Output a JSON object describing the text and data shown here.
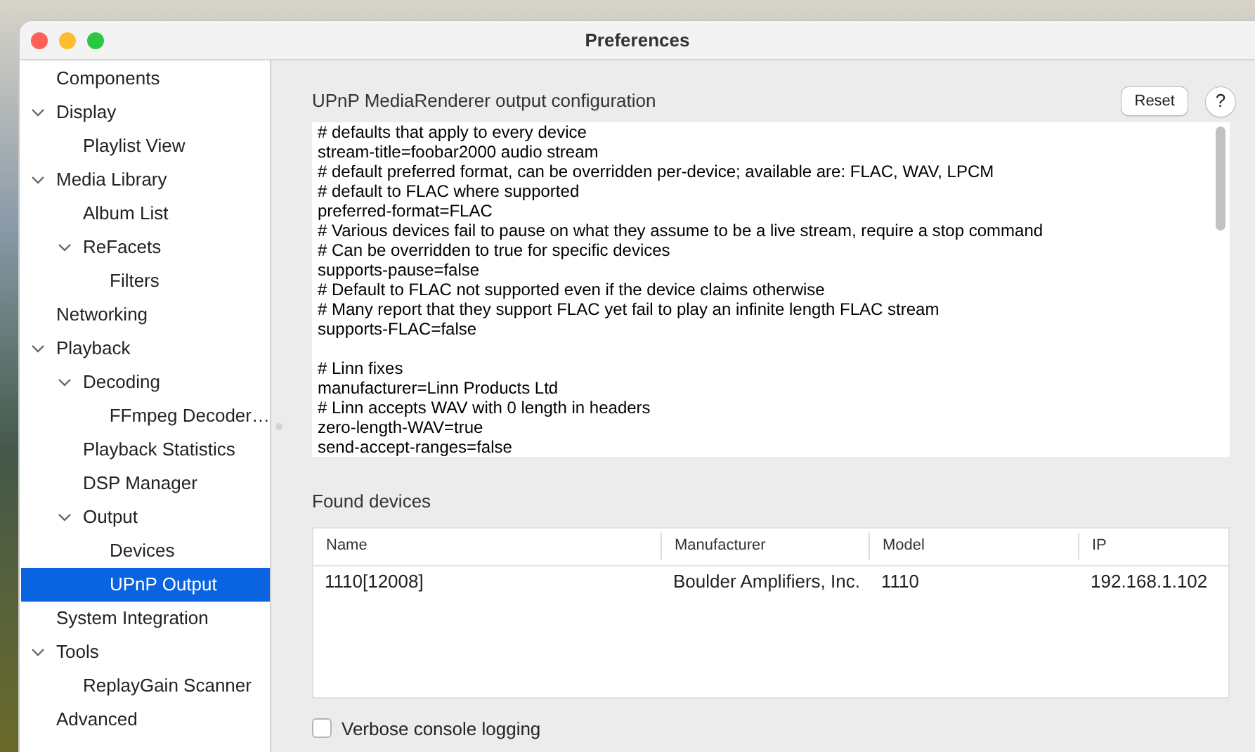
{
  "window": {
    "title": "Preferences"
  },
  "sidebar": {
    "items": [
      {
        "label": "Components",
        "selected": false
      },
      {
        "label": "Display",
        "expanded": true,
        "selected": false,
        "children": [
          {
            "label": "Playlist View",
            "selected": false
          }
        ]
      },
      {
        "label": "Media Library",
        "expanded": true,
        "selected": false,
        "children": [
          {
            "label": "Album List",
            "selected": false
          },
          {
            "label": "ReFacets",
            "expanded": true,
            "selected": false,
            "children": [
              {
                "label": "Filters",
                "selected": false
              }
            ]
          }
        ]
      },
      {
        "label": "Networking",
        "selected": false
      },
      {
        "label": "Playback",
        "expanded": true,
        "selected": false,
        "children": [
          {
            "label": "Decoding",
            "expanded": true,
            "selected": false,
            "children": [
              {
                "label": "FFmpeg Decoder…",
                "selected": false
              }
            ]
          },
          {
            "label": "Playback Statistics",
            "selected": false
          },
          {
            "label": "DSP Manager",
            "selected": false
          },
          {
            "label": "Output",
            "expanded": true,
            "selected": false,
            "children": [
              {
                "label": "Devices",
                "selected": false
              },
              {
                "label": "UPnP Output",
                "selected": true
              }
            ]
          }
        ]
      },
      {
        "label": "System Integration",
        "selected": false
      },
      {
        "label": "Tools",
        "expanded": true,
        "selected": false,
        "children": [
          {
            "label": "ReplayGain Scanner",
            "selected": false
          }
        ]
      },
      {
        "label": "Advanced",
        "selected": false
      }
    ]
  },
  "config": {
    "title": "UPnP MediaRenderer output configuration",
    "reset_button": "Reset",
    "help_button": "?",
    "text": "# defaults that apply to every device\nstream-title=foobar2000 audio stream\n# default preferred format, can be overridden per-device; available are: FLAC, WAV, LPCM\n# default to FLAC where supported\npreferred-format=FLAC\n# Various devices fail to pause on what they assume to be a live stream, require a stop command\n# Can be overridden to true for specific devices\nsupports-pause=false\n# Default to FLAC not supported even if the device claims otherwise\n# Many report that they support FLAC yet fail to play an infinite length FLAC stream\nsupports-FLAC=false\n\n# Linn fixes\nmanufacturer=Linn Products Ltd\n# Linn accepts WAV with 0 length in headers\nzero-length-WAV=true\nsend-accept-ranges=false"
  },
  "devices": {
    "title": "Found devices",
    "columns": [
      "Name",
      "Manufacturer",
      "Model",
      "IP"
    ],
    "rows": [
      {
        "cells": [
          "1110[12008]",
          "Boulder Amplifiers, Inc.",
          "1110",
          "192.168.1.102"
        ],
        "selected": false
      }
    ]
  },
  "verbose_logging": {
    "label": "Verbose console logging",
    "checked": false
  }
}
